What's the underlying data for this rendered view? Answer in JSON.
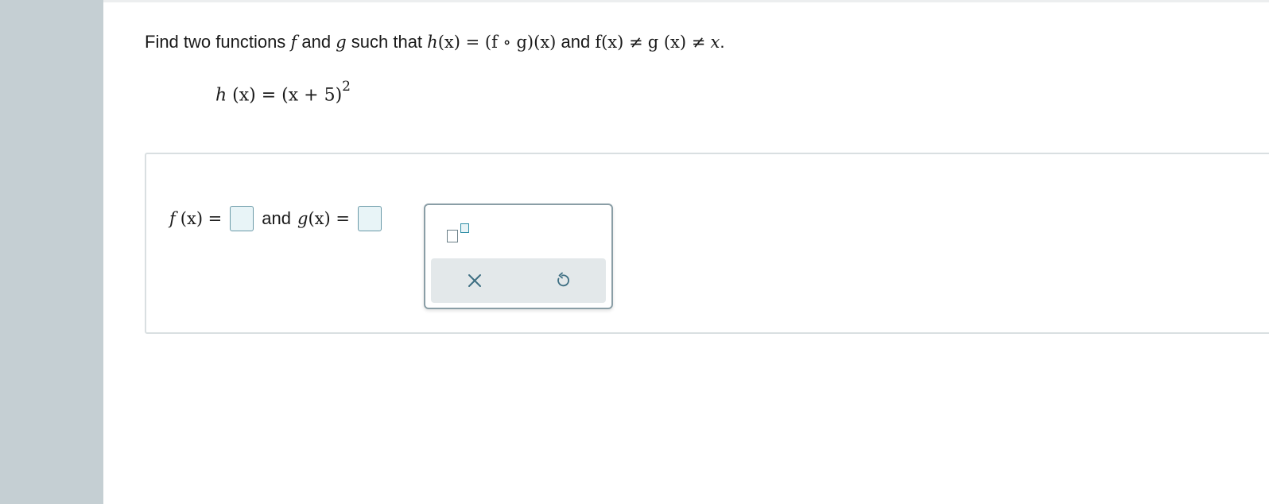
{
  "question": {
    "lead": "Find two functions",
    "f": "f",
    "and1": "and",
    "g": "g",
    "such_that": "such that",
    "h_def": "(x) = (f ∘ g)(x)",
    "and2": "and",
    "condition_f": "f(x) ≠",
    "condition_g": "g (x) ≠",
    "condition_x": "x",
    "period": "."
  },
  "given": {
    "name": "h",
    "arg": " (x) = (x + 5)",
    "exponent": "2"
  },
  "answer": {
    "f_label": "f",
    "f_arg": "(x) =",
    "and_label": "and",
    "g_label": "g",
    "g_arg": " (x) ="
  },
  "palette": {
    "superscript_tool": "superscript",
    "clear_icon": "close-icon",
    "undo_icon": "undo-icon"
  },
  "colors": {
    "rail": "#c5cfd3",
    "input_border": "#6b9aa8",
    "input_fill": "#e8f4f7",
    "icon": "#3d6e82"
  }
}
